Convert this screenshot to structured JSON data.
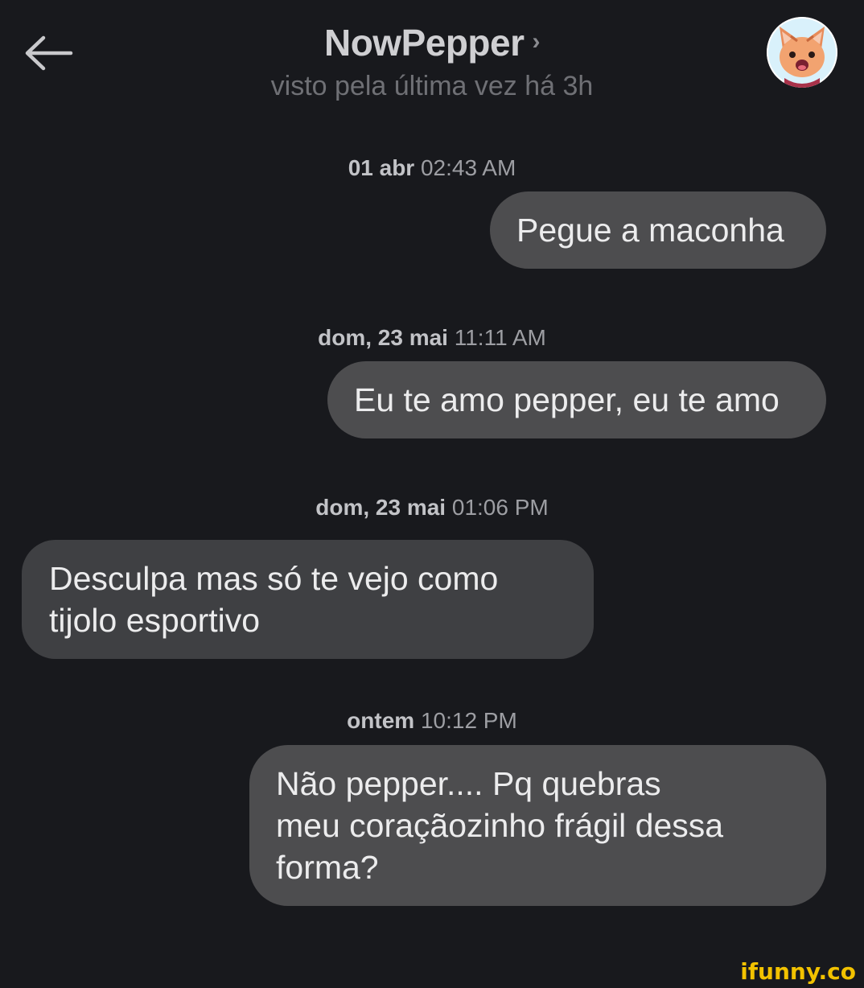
{
  "header": {
    "title": "NowPepper",
    "chevron": "›",
    "status": "visto pela última vez há 3h",
    "back_icon": "arrow-left-icon",
    "avatar_icon": "cat-avatar-icon"
  },
  "messages": [
    {
      "date": "01 abr",
      "time": "02:43 AM",
      "text": "Pegue a maconha",
      "direction": "outgoing"
    },
    {
      "date": "dom, 23 mai",
      "time": "11:11 AM",
      "text": "Eu te amo pepper, eu te amo",
      "direction": "outgoing"
    },
    {
      "date": "dom, 23 mai",
      "time": "01:06 PM",
      "lines": [
        "Desculpa mas só te vejo como",
        "tijolo esportivo"
      ],
      "direction": "incoming"
    },
    {
      "date": "ontem",
      "time": "10:12 PM",
      "lines": [
        "Não pepper.... Pq quebras",
        "meu coraçãozinho frágil dessa",
        "forma?"
      ],
      "direction": "outgoing"
    }
  ],
  "watermark": "ifunny.co",
  "colors": {
    "background": "#18191d",
    "outgoing_bubble": "#4d4d4f",
    "incoming_bubble": "#3f4043",
    "watermark": "#f2c200"
  }
}
